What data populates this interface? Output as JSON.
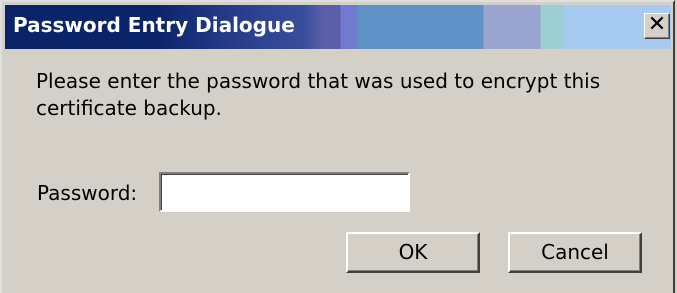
{
  "window": {
    "title": "Password Entry Dialogue",
    "close_glyph": "✕"
  },
  "dialog": {
    "message": "Please enter the password that was used to encrypt this certificate backup.",
    "password_label": "Password:",
    "password_value": "",
    "password_placeholder": "",
    "ok_label": "OK",
    "cancel_label": "Cancel"
  },
  "colors": {
    "face": "#d4d0c8",
    "title_active": "#0a246a",
    "title_text": "#ffffff"
  }
}
